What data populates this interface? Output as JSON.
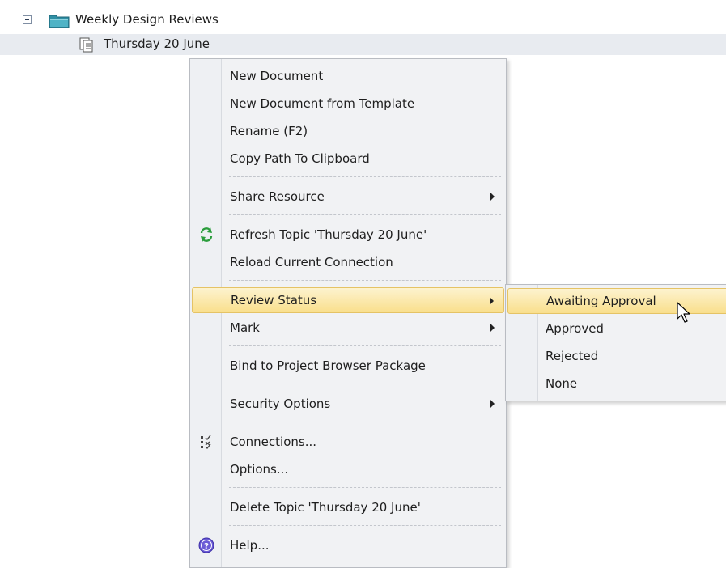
{
  "tree": {
    "root": {
      "label": "Weekly Design Reviews",
      "icon": "folder-icon"
    },
    "child": {
      "label": "Thursday 20 June",
      "icon": "document-stack-icon"
    }
  },
  "context_menu": {
    "items": [
      {
        "label": "New Document"
      },
      {
        "label": "New Document from Template"
      },
      {
        "label": "Rename (F2)"
      },
      {
        "label": "Copy Path To Clipboard"
      },
      {
        "label": "Share Resource",
        "submenu": true
      },
      {
        "label": "Refresh Topic 'Thursday 20 June'",
        "icon": "refresh-icon"
      },
      {
        "label": "Reload Current Connection"
      },
      {
        "label": "Review Status",
        "submenu": true,
        "highlighted": true
      },
      {
        "label": "Mark",
        "submenu": true
      },
      {
        "label": "Bind to Project Browser Package"
      },
      {
        "label": "Security Options",
        "submenu": true
      },
      {
        "label": "Connections...",
        "icon": "connections-icon"
      },
      {
        "label": "Options..."
      },
      {
        "label": "Delete Topic 'Thursday 20 June'"
      },
      {
        "label": "Help...",
        "icon": "help-icon"
      }
    ]
  },
  "review_status_submenu": {
    "items": [
      {
        "label": "Awaiting Approval",
        "highlighted": true
      },
      {
        "label": "Approved"
      },
      {
        "label": "Rejected"
      },
      {
        "label": "None"
      }
    ]
  },
  "colors": {
    "highlight_top": "#fdf3cf",
    "highlight_bottom": "#f9df8c",
    "highlight_border": "#e5c365",
    "menu_background": "#f1f2f4",
    "selected_row": "#e8ebf0"
  }
}
